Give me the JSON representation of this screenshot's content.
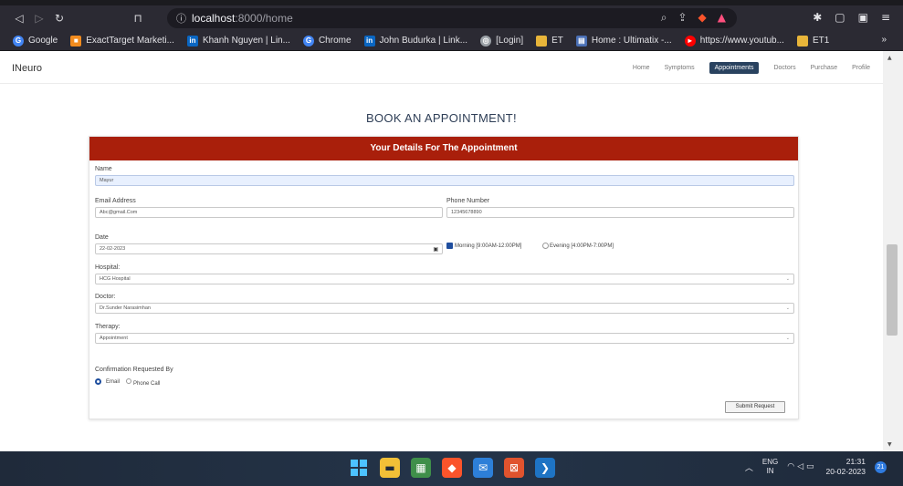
{
  "browser": {
    "url_host": "localhost",
    "url_path": ":8000/home",
    "bookmarks": [
      {
        "label": "Google",
        "icon": "google-icon",
        "color": "#4285f4"
      },
      {
        "label": "ExactTarget Marketi...",
        "icon": "exacttarget-icon",
        "color": "#f28c1f"
      },
      {
        "label": "Khanh Nguyen | Lin...",
        "icon": "linkedin-icon",
        "color": "#0a66c2"
      },
      {
        "label": "Chrome",
        "icon": "google-icon",
        "color": "#4285f4"
      },
      {
        "label": "John Budurka | Link...",
        "icon": "linkedin-icon",
        "color": "#0a66c2"
      },
      {
        "label": "[Login]",
        "icon": "globe-icon",
        "color": "#9aa0a6"
      },
      {
        "label": "ET",
        "icon": "folder-icon",
        "color": "#e8b53a"
      },
      {
        "label": "Home : Ultimatix -...",
        "icon": "ultimatix-icon",
        "color": "#4a6fb5"
      },
      {
        "label": "https://www.youtub...",
        "icon": "youtube-icon",
        "color": "#ff0000"
      },
      {
        "label": "ET1",
        "icon": "folder-icon",
        "color": "#e8b53a"
      }
    ],
    "bookmarks_more": "»"
  },
  "site": {
    "brand": "INeuro",
    "nav": [
      "Home",
      "Symptoms",
      "Appointments",
      "Doctors",
      "Purchase",
      "Profile"
    ],
    "active_nav": "Appointments"
  },
  "form": {
    "heading": "BOOK AN APPOINTMENT!",
    "card_title": "Your Details For The Appointment",
    "name_label": "Name",
    "name_value": "Mayur",
    "email_label": "Email Address",
    "email_value": "Abc@gmail.Com",
    "phone_label": "Phone Number",
    "phone_value": "12345678890",
    "date_label": "Date",
    "date_value": "22-02-2023",
    "morning_label": "Morning [9:00AM-12:00PM]",
    "evening_label": "Evening [4:00PM-7:00PM]",
    "morning_checked": true,
    "hospital_label": "Hospital:",
    "hospital_value": "HCG Hospital",
    "doctor_label": "Doctor:",
    "doctor_value": "Dr.Sunder Narasimhan",
    "therapy_label": "Therapy:",
    "therapy_value": "Appointment",
    "confirm_label": "Confirmation Requested By",
    "email_opt": "Email",
    "phone_opt": "Phone Call",
    "submit_label": "Submit Request"
  },
  "taskbar": {
    "lang_top": "ENG",
    "lang_bottom": "IN",
    "time": "21:31",
    "date": "20-02-2023",
    "notif_count": "21"
  }
}
